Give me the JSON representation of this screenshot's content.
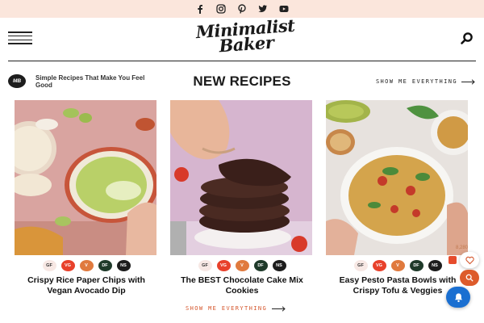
{
  "social": {
    "icons": [
      "facebook-icon",
      "instagram-icon",
      "pinterest-icon",
      "twitter-icon",
      "youtube-icon"
    ]
  },
  "header": {
    "logo_line1": "Minimalist",
    "logo_line2": "Baker"
  },
  "section": {
    "badge": "MB",
    "tagline": "Simple Recipes That Make You Feel Good",
    "title": "NEW RECIPES",
    "show_all_label": "SHOW ME EVERYTHING"
  },
  "recipes": [
    {
      "title": "Crispy Rice Paper Chips with Vegan Avocado Dip",
      "tags": [
        "GF",
        "VG",
        "V",
        "DF",
        "NS"
      ]
    },
    {
      "title": "The BEST Chocolate Cake Mix Cookies",
      "tags": [
        "GF",
        "VG",
        "V",
        "DF",
        "NS"
      ]
    },
    {
      "title": "Easy Pesto Pasta Bowls with Crispy Tofu & Veggies",
      "tags": [
        "GF",
        "VG",
        "V",
        "DF",
        "NS"
      ]
    }
  ],
  "footer": {
    "show_all_label": "SHOW ME EVERYTHING"
  },
  "widgets": {
    "save_count": "8,280"
  },
  "colors": {
    "social_bar_bg": "#fbe6dc",
    "accent": "#d4552b",
    "tag_vg": "#e8412b",
    "tag_v": "#e07a3e",
    "tag_df": "#1f3a2a",
    "notification_blue": "#1a6fd1"
  }
}
